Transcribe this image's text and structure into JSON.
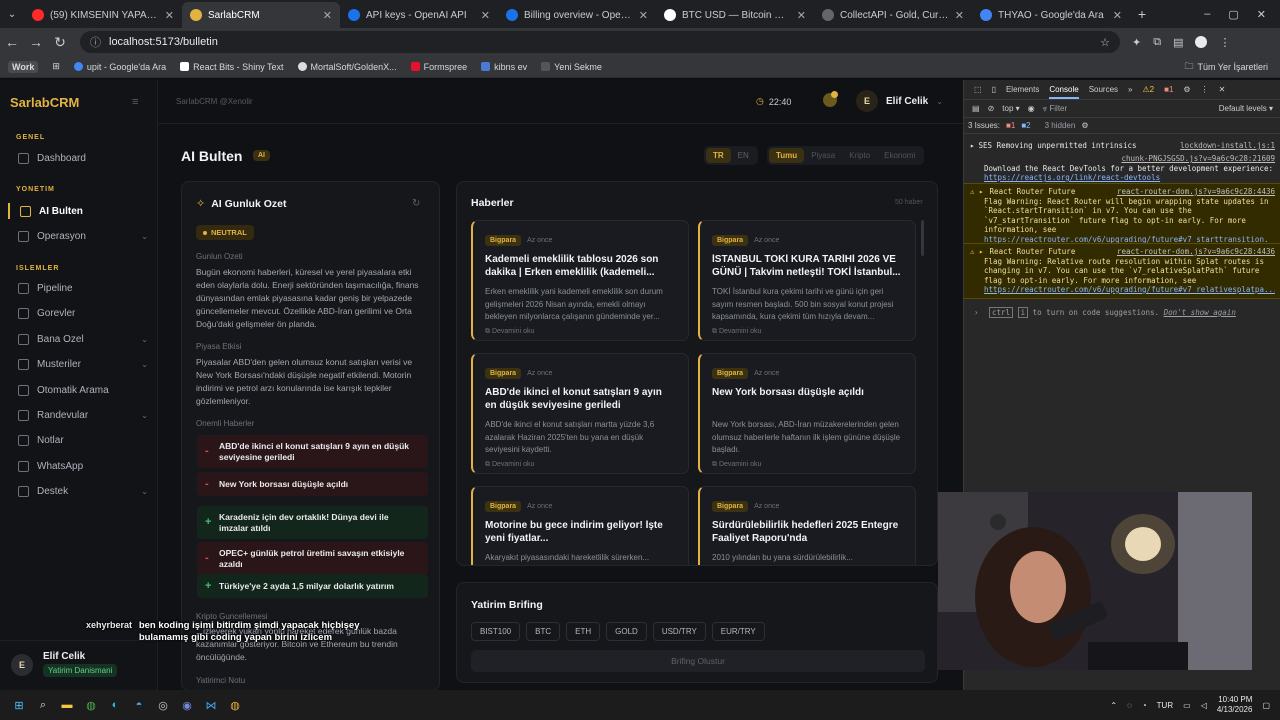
{
  "browser": {
    "tabs": [
      {
        "title": "(59) KİMSENİN YAPAMADIĞI O...",
        "color": "#ff2b2b"
      },
      {
        "title": "SarlabCRM",
        "color": "#e3b341",
        "active": true
      },
      {
        "title": "API keys - OpenAI API",
        "color": "#1a73e8"
      },
      {
        "title": "Billing overview - OpenAI API",
        "color": "#1a73e8"
      },
      {
        "title": "BTC USD — Bitcoin Dolar Fiyatı",
        "color": "#ffffff"
      },
      {
        "title": "CollectAPI - Gold, Currency and...",
        "color": "#666"
      },
      {
        "title": "THYAO - Google'da Ara",
        "color": "#4285f4"
      }
    ],
    "url": "localhost:5173/bulletin",
    "bookmarks": [
      "Work",
      "upit - Google'da Ara",
      "React Bits - Shiny Text",
      "MortalSoft/GoldenX...",
      "Formspree",
      "kibns ev",
      "Yeni Sekme"
    ],
    "all_bookmarks": "Tüm Yer İşaretleri"
  },
  "sidebar": {
    "brand": "SarlabCRM",
    "sections": {
      "genel": "GENEL",
      "yonetim": "YONETIM",
      "islemler": "ISLEMLER"
    },
    "items": [
      {
        "label": "Dashboard"
      },
      {
        "label": "AI Bulten",
        "active": true
      },
      {
        "label": "Operasyon",
        "chevron": true
      },
      {
        "label": "Pipeline"
      },
      {
        "label": "Gorevler"
      },
      {
        "label": "Bana Ozel",
        "chevron": true
      },
      {
        "label": "Musteriler",
        "chevron": true
      },
      {
        "label": "Otomatik Arama"
      },
      {
        "label": "Randevular",
        "chevron": true
      },
      {
        "label": "Notlar"
      },
      {
        "label": "WhatsApp"
      },
      {
        "label": "Destek",
        "chevron": true
      }
    ],
    "user": {
      "initial": "E",
      "name": "Elif Celik",
      "role": "Yatirim Danismani"
    }
  },
  "topbar": {
    "breadcrumb": "SarlabCRM @Xenolir",
    "time": "22:40",
    "user_initial": "E",
    "user_name": "Elif Celik"
  },
  "page": {
    "title": "AI Bulten",
    "badge": "AI",
    "langs": [
      "TR",
      "EN"
    ],
    "filters": [
      "Tumu",
      "Piyasa",
      "Kripto",
      "Ekonomi"
    ]
  },
  "summary": {
    "title": "AI Gunluk Ozet",
    "sentiment": "NEUTRAL",
    "general_label": "Gunlun Ozeti",
    "general_text": "Bugün ekonomi haberleri, küresel ve yerel piyasalara etki eden olaylarla dolu. Enerji sektöründen taşımacılığa, finans dünyasından emlak piyasasına kadar geniş bir yelpazede güncellemeler mevcut. Özellikle ABD-İran gerilimi ve Orta Doğu'daki gelişmeler ön planda.",
    "market_label": "Piyasa Etkisi",
    "market_text": "Piyasalar ABD'den gelen olumsuz konut satışları verisi ve New York Borsası'ndaki düşüşle negatif etkilendi. Motorin indirimi ve petrol arzı konularında ise karışık tepkiler gözlemleniyor.",
    "important_label": "Onemli Haberler",
    "important": [
      {
        "sign": "-",
        "text": "ABD'de ikinci el konut satışları 9 ayın en düşük seviyesine geriledi",
        "type": "neg"
      },
      {
        "sign": "-",
        "text": "New York borsası düşüşle açıldı",
        "type": "neg"
      },
      {
        "sign": "+",
        "text": "Karadeniz için dev ortaklık! Dünya devi ile imzalar atıldı",
        "type": "pos"
      },
      {
        "sign": "-",
        "text": "OPEC+ günlük petrol üretimi savaşın etkisiyle azaldı",
        "type": "neg"
      },
      {
        "sign": "+",
        "text": "Türkiye'ye 2 ayda 1,5 milyar dolarlık yatırım",
        "type": "pos"
      }
    ],
    "crypto_label": "Kripto Guncellemesi",
    "crypto_text_partial": "...izleyerek yukarı yönlü hareket ederek günlük bazda kazanımlar gösteriyor. Bitcoin ve Ethereum bu trendin öncülüğünde.",
    "investor_label": "Yatirimci Notu"
  },
  "news": {
    "title": "Haberler",
    "count": "50 haber",
    "items": [
      {
        "source": "Bigpara",
        "ago": "Az once",
        "title": "Kademeli emeklilik tablosu 2026 son dakika | Erken emeklilik (kademeli...",
        "desc": "Erken emeklilik yani kademeli emeklilik son durum gelişmeleri 2026 Nisan ayında, emekli olmayı bekleyen milyonlarca çalışanın gündeminde yer...",
        "more": "Devamini oku"
      },
      {
        "source": "Bigpara",
        "ago": "Az once",
        "title": "İSTANBUL TOKİ KURA TARİHİ 2026 VE GÜNÜ | Takvim netleşti! TOKİ İstanbul...",
        "desc": "TOKİ İstanbul kura çekimi tarihi ve günü için geri sayım resmen başladı. 500 bin sosyal konut projesi kapsamında, kura çekimi tüm hızıyla devam...",
        "more": "Devamini oku"
      },
      {
        "source": "Bigpara",
        "ago": "Az once",
        "title": "ABD'de ikinci el konut satışları 9 ayın en düşük seviyesine geriledi",
        "desc": "ABD'de ikinci el konut satışları martta yüzde 3,6 azalarak Haziran 2025'ten bu yana en düşük seviyesini kaydetti.",
        "more": "Devamini oku"
      },
      {
        "source": "Bigpara",
        "ago": "Az once",
        "title": "New York borsası düşüşle açıldı",
        "desc": "New York borsası, ABD-İran müzakerelerinden gelen olumsuz haberlerle haftanın ilk işlem gününe düşüşle başladı.",
        "more": "Devamini oku"
      },
      {
        "source": "Bigpara",
        "ago": "Az once",
        "title": "Motorine bu gece indirim geliyor! İşte yeni fiyatlar...",
        "desc": "Akaryakıt piyasasındaki hareketlilik sürerken...",
        "more": ""
      },
      {
        "source": "Bigpara",
        "ago": "Az once",
        "title": "Sürdürülebilirlik hedefleri 2025 Entegre Faaliyet Raporu'nda",
        "desc": "2010 yılından bu yana sürdürülebilirlik...",
        "more": ""
      }
    ]
  },
  "brief": {
    "title": "Yatirim Brifing",
    "chips": [
      "BIST100",
      "BTC",
      "ETH",
      "GOLD",
      "USD/TRY",
      "EUR/TRY"
    ],
    "button": "Brifing Olustur"
  },
  "devtools": {
    "tabs": [
      "Elements",
      "Console",
      "Sources"
    ],
    "warn_count": "2",
    "err_count": "1",
    "context": "top",
    "filter": "Filter",
    "levels": "Default levels",
    "issues": "3 Issues:",
    "issues_err": "1",
    "issues_info": "2",
    "hidden": "3 hidden",
    "logs": [
      {
        "kind": "info",
        "text": "SES Removing unpermitted intrinsics",
        "src": "lockdown-install.js:1"
      },
      {
        "kind": "info",
        "src": "chunk-PNGJSGSD.js?v=9a6c9c28:21609",
        "text": "Download the React DevTools for a better development experience:",
        "link": "https://reactjs.org/link/react-devtools"
      },
      {
        "kind": "warn",
        "title": "React Router Future",
        "src": "react-router-dom.js?v=9a6c9c28:4436",
        "text": "Flag Warning: React Router will begin wrapping state updates in `React.startTransition` in v7. You can use the `v7_startTransition` future flag to opt-in early. For more information, see",
        "link": "https://reactrouter.com/v6/upgrading/future#v7_starttransition."
      },
      {
        "kind": "warn",
        "title": "React Router Future",
        "src": "react-router-dom.js?v=9a6c9c28:4436",
        "text": "Flag Warning: Relative route resolution within Splat routes is changing in v7. You can use the `v7_relativeSplatPath` future flag to opt-in early. For more information, see",
        "link": "https://reactrouter.com/v6/upgrading/future#v7_relativesplatpa..."
      }
    ],
    "hint_key1": "ctrl",
    "hint_key2": "i",
    "hint_text": "to turn on code suggestions.",
    "hint_link": "Don't show again"
  },
  "chat": {
    "user": "xehyrberat",
    "message": "ben koding işimi bitirdim şimdi yapacak hiçbişey bulamamış gibi coding yapan birini izlicem"
  },
  "taskbar": {
    "lang": "TUR",
    "time": "10:40 PM",
    "date": "4/13/2026"
  }
}
